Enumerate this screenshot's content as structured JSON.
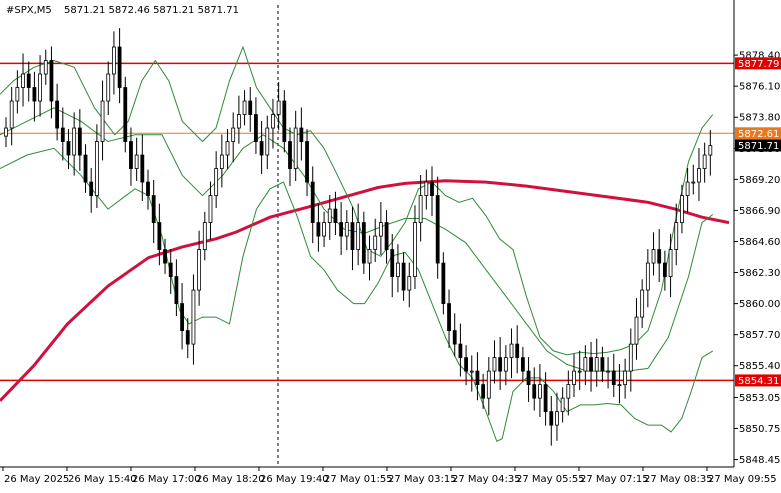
{
  "header": {
    "symbol": "#SPX,M5",
    "ohlc": "5871.21 5872.46 5871.21 5871.71"
  },
  "colors": {
    "bull_candle": "#ffffff",
    "bear_candle": "#000000",
    "bollinger": "#2e8b3a",
    "moving_average": "#d0103e",
    "support_resistance": "#e00000",
    "current_level_line": "#e8781e",
    "price_badge": "#e00000",
    "last_price_badge": "#000000"
  },
  "chart_data": {
    "type": "candlestick",
    "ylim": [
      5847.9,
      5881.0
    ],
    "y_ticks": [
      "5878.40",
      "5876.10",
      "5873.80",
      "5871.50",
      "5869.20",
      "5866.90",
      "5864.60",
      "5862.30",
      "5860.00",
      "5857.70",
      "5855.40",
      "5853.05",
      "5850.75",
      "5848.45"
    ],
    "x_ticks": [
      "26 May 2025",
      "26 May 15:40",
      "26 May 17:00",
      "26 May 18:20",
      "26 May 19:40",
      "27 May 01:55",
      "27 May 03:15",
      "27 May 04:35",
      "27 May 05:55",
      "27 May 07:15",
      "27 May 08:35",
      "27 May 09:55"
    ],
    "horizontal_levels": [
      {
        "label": "5877.79",
        "value": 5877.79,
        "style": "resistance"
      },
      {
        "label": "5872.61",
        "value": 5872.61,
        "style": "current"
      },
      {
        "label": "5854.31",
        "value": 5854.31,
        "style": "support"
      }
    ],
    "last_price": {
      "label": "5871.71",
      "value": 5871.71
    },
    "series": [
      {
        "name": "",
        "type": "candles",
        "close_path": [
          5873,
          5875,
          5876,
          5877,
          5876,
          5875,
          5877,
          5878,
          5875,
          5873,
          5872,
          5871,
          5873,
          5871,
          5869,
          5868,
          5872,
          5875,
          5877,
          5879,
          5876,
          5872,
          5870,
          5871,
          5869,
          5868,
          5866,
          5864,
          5863,
          5862,
          5860,
          5858,
          5857,
          5861,
          5864,
          5866,
          5868,
          5870,
          5871,
          5872,
          5873,
          5874,
          5875,
          5874,
          5872,
          5871,
          5873,
          5874,
          5875,
          5872,
          5870,
          5873,
          5872,
          5869,
          5866,
          5865,
          5866,
          5867,
          5866,
          5865,
          5866,
          5864,
          5866,
          5863,
          5864,
          5865,
          5866,
          5864,
          5862,
          5863,
          5861,
          5862,
          5866,
          5868,
          5869,
          5868,
          5863,
          5860,
          5858,
          5857,
          5856,
          5855,
          5855,
          5854,
          5853,
          5855,
          5856,
          5855,
          5856,
          5857,
          5856,
          5855,
          5854,
          5853,
          5854,
          5852,
          5851,
          5852,
          5853,
          5854,
          5855,
          5855,
          5856,
          5855,
          5856,
          5855,
          5855,
          5854,
          5854,
          5855,
          5857,
          5859,
          5861,
          5863,
          5864,
          5863,
          5862,
          5864,
          5866,
          5868,
          5869,
          5869,
          5870,
          5871,
          5871.7
        ]
      },
      {
        "name": "",
        "type": "line",
        "label": "moving average (red)",
        "points": [
          [
            0,
            5852.8
          ],
          [
            25,
            5855.4
          ],
          [
            50,
            5858.5
          ],
          [
            80,
            5861.3
          ],
          [
            110,
            5863.4
          ],
          [
            135,
            5864.2
          ],
          [
            160,
            5864.8
          ],
          [
            175,
            5865.3
          ],
          [
            200,
            5866.4
          ],
          [
            230,
            5867.2
          ],
          [
            255,
            5867.9
          ],
          [
            280,
            5868.6
          ],
          [
            300,
            5868.9
          ],
          [
            330,
            5869.1
          ],
          [
            360,
            5869.0
          ],
          [
            390,
            5868.7
          ],
          [
            420,
            5868.3
          ],
          [
            450,
            5867.9
          ],
          [
            480,
            5867.5
          ],
          [
            500,
            5867.0
          ],
          [
            520,
            5866.4
          ],
          [
            540,
            5866.0
          ]
        ]
      },
      {
        "name": "",
        "type": "line",
        "label": "bollinger upper",
        "points": [
          [
            0,
            5875.5
          ],
          [
            10,
            5876.5
          ],
          [
            25,
            5877.5
          ],
          [
            40,
            5878.0
          ],
          [
            55,
            5877.5
          ],
          [
            70,
            5874.5
          ],
          [
            85,
            5872.5
          ],
          [
            95,
            5873.5
          ],
          [
            105,
            5876.5
          ],
          [
            115,
            5878.0
          ],
          [
            125,
            5876.5
          ],
          [
            135,
            5873.5
          ],
          [
            150,
            5872.0
          ],
          [
            160,
            5873.0
          ],
          [
            170,
            5876.5
          ],
          [
            180,
            5879.0
          ],
          [
            190,
            5876.0
          ],
          [
            200,
            5874.5
          ],
          [
            210,
            5873.0
          ],
          [
            220,
            5872.5
          ],
          [
            230,
            5872.8
          ],
          [
            240,
            5871.5
          ],
          [
            250,
            5869.5
          ],
          [
            262,
            5867.0
          ],
          [
            272,
            5864.0
          ],
          [
            282,
            5863.5
          ],
          [
            290,
            5864.5
          ],
          [
            300,
            5866.0
          ],
          [
            310,
            5868.5
          ],
          [
            320,
            5869.0
          ],
          [
            330,
            5868.0
          ],
          [
            340,
            5867.5
          ],
          [
            350,
            5867.8
          ],
          [
            360,
            5866.5
          ],
          [
            370,
            5864.8
          ],
          [
            380,
            5864.0
          ],
          [
            390,
            5860.5
          ],
          [
            400,
            5857.5
          ],
          [
            410,
            5856.5
          ],
          [
            420,
            5856.2
          ],
          [
            430,
            5856.4
          ],
          [
            440,
            5856.3
          ],
          [
            450,
            5856.4
          ],
          [
            460,
            5856.6
          ],
          [
            470,
            5857.0
          ],
          [
            480,
            5858.0
          ],
          [
            490,
            5861.0
          ],
          [
            500,
            5866.0
          ],
          [
            510,
            5870.5
          ],
          [
            520,
            5873.0
          ],
          [
            528,
            5874.0
          ]
        ]
      },
      {
        "name": "",
        "type": "line",
        "label": "bollinger middle",
        "points": [
          [
            0,
            5872.5
          ],
          [
            20,
            5873.5
          ],
          [
            40,
            5874.5
          ],
          [
            60,
            5873.5
          ],
          [
            80,
            5872.0
          ],
          [
            100,
            5872.5
          ],
          [
            120,
            5872.5
          ],
          [
            135,
            5869.5
          ],
          [
            150,
            5868.0
          ],
          [
            165,
            5869.5
          ],
          [
            180,
            5871.5
          ],
          [
            195,
            5872.5
          ],
          [
            210,
            5871.5
          ],
          [
            225,
            5869.5
          ],
          [
            240,
            5867.0
          ],
          [
            255,
            5865.5
          ],
          [
            270,
            5865.2
          ],
          [
            285,
            5865.8
          ],
          [
            300,
            5866.3
          ],
          [
            315,
            5866.3
          ],
          [
            330,
            5865.5
          ],
          [
            345,
            5864.5
          ],
          [
            360,
            5862.5
          ],
          [
            375,
            5860.5
          ],
          [
            390,
            5858.5
          ],
          [
            405,
            5856.5
          ],
          [
            420,
            5855.5
          ],
          [
            435,
            5855.0
          ],
          [
            450,
            5855.0
          ],
          [
            465,
            5855.0
          ],
          [
            480,
            5855.2
          ],
          [
            495,
            5857.5
          ],
          [
            510,
            5862.0
          ],
          [
            520,
            5866.0
          ],
          [
            528,
            5866.6
          ]
        ]
      },
      {
        "name": "",
        "type": "line",
        "label": "bollinger lower",
        "points": [
          [
            0,
            5870.0
          ],
          [
            20,
            5871.0
          ],
          [
            40,
            5871.5
          ],
          [
            60,
            5869.5
          ],
          [
            80,
            5867.0
          ],
          [
            100,
            5868.5
          ],
          [
            110,
            5868.0
          ],
          [
            120,
            5865.0
          ],
          [
            128,
            5861.5
          ],
          [
            133,
            5859.5
          ],
          [
            140,
            5858.5
          ],
          [
            150,
            5859.0
          ],
          [
            160,
            5859.0
          ],
          [
            170,
            5858.5
          ],
          [
            180,
            5863.5
          ],
          [
            190,
            5867.0
          ],
          [
            200,
            5868.5
          ],
          [
            210,
            5869.0
          ],
          [
            220,
            5866.5
          ],
          [
            230,
            5863.5
          ],
          [
            240,
            5862.5
          ],
          [
            250,
            5861.0
          ],
          [
            262,
            5860.0
          ],
          [
            270,
            5860.0
          ],
          [
            280,
            5861.5
          ],
          [
            290,
            5863.5
          ],
          [
            300,
            5863.8
          ],
          [
            310,
            5862.5
          ],
          [
            320,
            5860.0
          ],
          [
            330,
            5857.5
          ],
          [
            340,
            5855.5
          ],
          [
            350,
            5854.5
          ],
          [
            360,
            5852.0
          ],
          [
            368,
            5849.8
          ],
          [
            372,
            5850.0
          ],
          [
            380,
            5853.5
          ],
          [
            390,
            5854.5
          ],
          [
            400,
            5854.5
          ],
          [
            410,
            5853.5
          ],
          [
            420,
            5852.0
          ],
          [
            430,
            5852.5
          ],
          [
            440,
            5852.5
          ],
          [
            450,
            5852.6
          ],
          [
            460,
            5852.5
          ],
          [
            470,
            5851.5
          ],
          [
            480,
            5851.0
          ],
          [
            490,
            5851.0
          ],
          [
            497,
            5850.5
          ],
          [
            505,
            5851.5
          ],
          [
            512,
            5853.5
          ],
          [
            520,
            5856.0
          ],
          [
            528,
            5856.5
          ]
        ]
      }
    ]
  }
}
